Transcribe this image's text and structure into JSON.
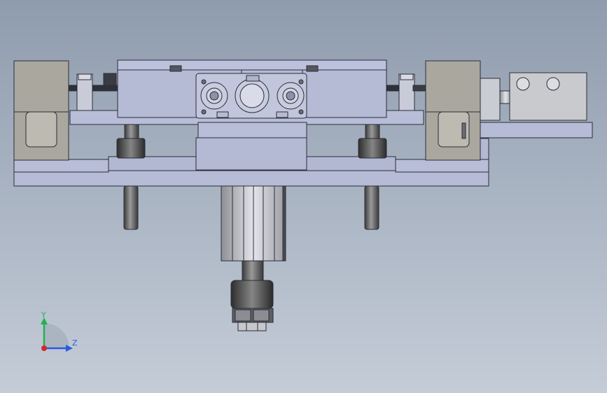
{
  "viewport": {
    "background_top": "#8f9cad",
    "background_bottom": "#c4ccd7"
  },
  "model": {
    "body_color": "#b7bcd8",
    "stroke_color": "#2b2d38",
    "block_color": "#a9a69d",
    "shaft_color": "#6f6f6f"
  },
  "triad": {
    "y_label": "Y",
    "z_label": "Z",
    "y_color": "#22b24c",
    "z_color": "#2a5be0",
    "x_color": "#d8262e"
  }
}
